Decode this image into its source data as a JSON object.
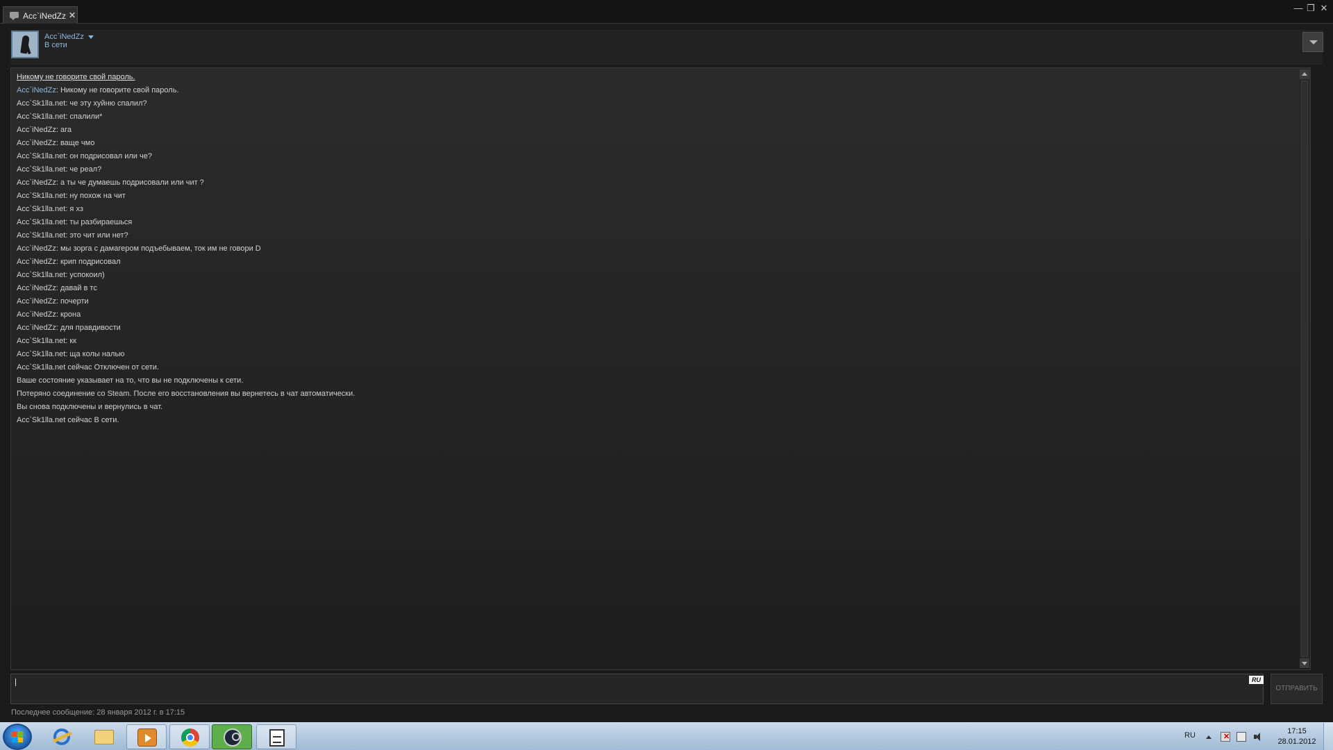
{
  "window": {
    "tab_label": "Acc`iNedZz",
    "tab_close": "✕",
    "controls": {
      "minimize": "—",
      "restore": "❐",
      "close": "✕"
    }
  },
  "header": {
    "friend_name": "Acc`iNedZz",
    "friend_status": "В сети"
  },
  "chat": {
    "warning": "Никому не говорите свой пароль.",
    "messages": [
      {
        "sender": "Acc`iNedZz",
        "text": ": Никому не говорите свой пароль.",
        "self": true
      },
      {
        "sender": "Acc`Sk1lla.net",
        "text": ": че эту хуйню спалил?"
      },
      {
        "sender": "Acc`Sk1lla.net",
        "text": ": спалили*"
      },
      {
        "sender": "Acc`iNedZz",
        "text": ": ага"
      },
      {
        "sender": "Acc`iNedZz",
        "text": ": ваще чмо"
      },
      {
        "sender": "Acc`Sk1lla.net",
        "text": ": он подрисовал или че?"
      },
      {
        "sender": "Acc`Sk1lla.net",
        "text": ": че реал?"
      },
      {
        "sender": "Acc`iNedZz",
        "text": ": а ты че думаешь подрисовали или чит ?"
      },
      {
        "sender": "Acc`Sk1lla.net",
        "text": ": ну похож на чит"
      },
      {
        "sender": "Acc`Sk1lla.net",
        "text": ": я хз"
      },
      {
        "sender": "Acc`Sk1lla.net",
        "text": ": ты разбираешься"
      },
      {
        "sender": "Acc`Sk1lla.net",
        "text": ": это чит или нет?"
      },
      {
        "sender": "Acc`iNedZz",
        "text": ": мы зорга с дамагером подъебываем, ток им не говори D"
      },
      {
        "sender": "Acc`iNedZz",
        "text": ": крип подрисовал"
      },
      {
        "sender": "Acc`Sk1lla.net",
        "text": ": успокоил)"
      },
      {
        "sender": "Acc`iNedZz",
        "text": ": давай в тс"
      },
      {
        "sender": "Acc`iNedZz",
        "text": ": почерти"
      },
      {
        "sender": "Acc`iNedZz",
        "text": ": крона"
      },
      {
        "sender": "Acc`iNedZz",
        "text": ": для правдивости"
      },
      {
        "sender": "Acc`Sk1lla.net",
        "text": ": кк"
      },
      {
        "sender": "Acc`Sk1lla.net",
        "text": ": ща колы налью"
      },
      {
        "sender": "",
        "text": "Acc`Sk1lla.net сейчас Отключен от сети."
      },
      {
        "sender": "",
        "text": "Ваше состояние указывает на то, что вы не подключены к сети."
      },
      {
        "sender": "",
        "text": "Потеряно соединение со Steam. После его восстановления вы вернетесь в чат автоматически."
      },
      {
        "sender": "",
        "text": "Вы снова подключены и вернулись в чат."
      },
      {
        "sender": "",
        "text": "Acc`Sk1lla.net сейчас В сети."
      }
    ]
  },
  "input": {
    "value": "",
    "lang_badge": "RU",
    "send_label": "ОТПРАВИТЬ"
  },
  "footer": {
    "last_message": "Последнее сообщение: 28 января 2012 г. в 17:15"
  },
  "taskbar": {
    "apps": [
      "internet-explorer",
      "windows-explorer",
      "media-player",
      "chrome",
      "steam",
      "notepad"
    ],
    "active_app": "steam",
    "tray_lang": "RU",
    "time": "17:15",
    "date": "28.01.2012"
  },
  "colors": {
    "background": "#1b1b1b",
    "self_name": "#8fb9de",
    "text": "#d2d2d2",
    "taskbar": "#b4cbe2",
    "steam_active": "#5fae4e"
  }
}
